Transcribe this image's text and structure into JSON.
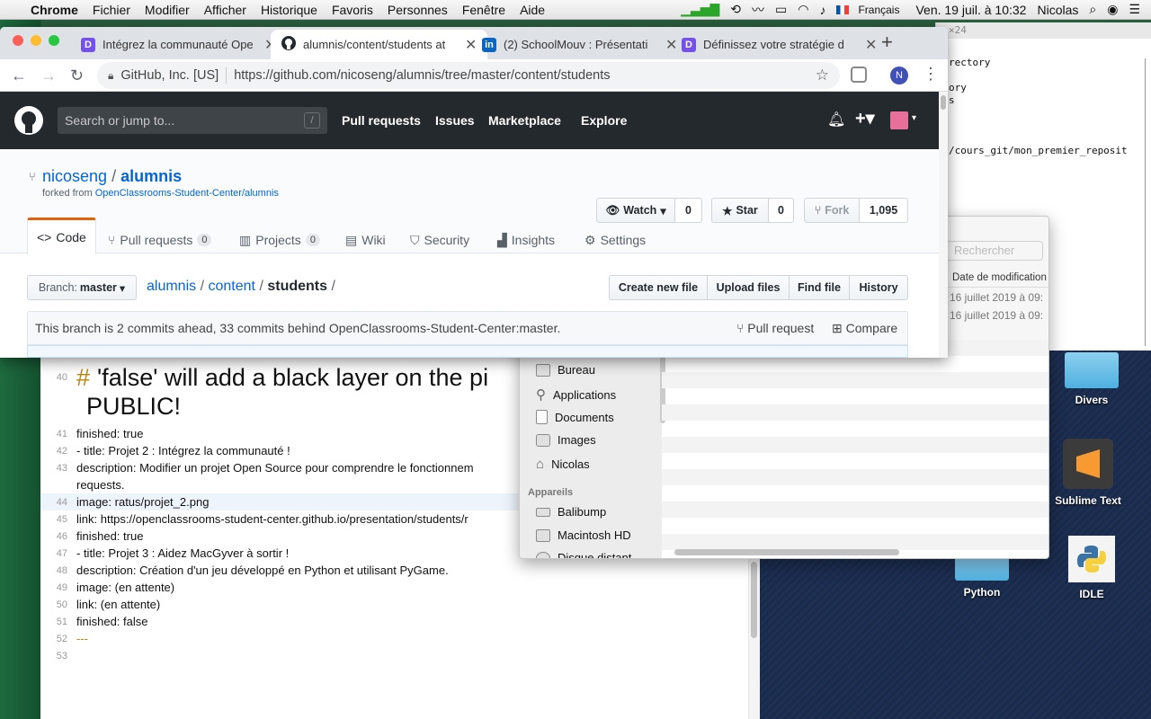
{
  "menubar": {
    "app": "Chrome",
    "items": [
      "Fichier",
      "Modifier",
      "Afficher",
      "Historique",
      "Favoris",
      "Personnes",
      "Fenêtre",
      "Aide"
    ],
    "input_source": "Français",
    "datetime": "Ven. 19 juil. à 10:32",
    "user": "Nicolas"
  },
  "browser": {
    "tabs": [
      {
        "title": "Intégrez la communauté Ope",
        "favicon": "openclassrooms-icon"
      },
      {
        "title": "alumnis/content/students at",
        "favicon": "github-icon",
        "active": true
      },
      {
        "title": "(2) SchoolMouv : Présentati",
        "favicon": "linkedin-icon"
      },
      {
        "title": "Définissez votre stratégie d",
        "favicon": "openclassrooms-icon"
      }
    ],
    "site_identity": "GitHub, Inc. [US]",
    "url": "https://github.com/nicoseng/alumnis/tree/master/content/students",
    "profile_initial": "N"
  },
  "github": {
    "search_placeholder": "Search or jump to...",
    "search_shortcut": "/",
    "nav": [
      "Pull requests",
      "Issues",
      "Marketplace",
      "Explore"
    ],
    "repo_owner": "nicoseng",
    "repo_sep": "/",
    "repo_name": "alumnis",
    "forked_prefix": "forked from",
    "forked_from": "OpenClassrooms-Student-Center/alumnis",
    "watch_label": "Watch",
    "watch_count": "0",
    "star_label": "Star",
    "star_count": "0",
    "fork_label": "Fork",
    "fork_count": "1,095",
    "tabs": [
      {
        "label": "Code"
      },
      {
        "label": "Pull requests",
        "count": "0"
      },
      {
        "label": "Projects",
        "count": "0"
      },
      {
        "label": "Wiki"
      },
      {
        "label": "Security"
      },
      {
        "label": "Insights"
      },
      {
        "label": "Settings"
      }
    ],
    "branch_label": "Branch:",
    "branch_value": "master",
    "path": [
      "alumnis",
      "content",
      "students"
    ],
    "path_sep": "/",
    "buttons": [
      "Create new file",
      "Upload files",
      "Find file",
      "History"
    ],
    "branch_status": "This branch is 2 commits ahead, 33 commits behind OpenClassrooms-Student-Center:master.",
    "pull_request_label": "Pull request",
    "compare_label": "Compare"
  },
  "editor": {
    "heading_line_no": "40",
    "heading_hash": "#",
    "heading_text": "'false' will add a black layer on the pi",
    "heading_cont": "PUBLIC!",
    "lines": [
      {
        "n": "41",
        "text": "finished: true"
      },
      {
        "n": "42",
        "text": "- title: Projet 2 : Intégrez la communauté !"
      },
      {
        "n": "43",
        "text": "description: Modifier un projet Open Source pour comprendre le fonctionnem"
      },
      {
        "n": "",
        "text": "requests."
      },
      {
        "n": "44",
        "text": "image: ratus/projet_2.png"
      },
      {
        "n": "45",
        "text": "link: https://openclassrooms-student-center.github.io/presentation/students/r"
      },
      {
        "n": "46",
        "text": "finished: true"
      },
      {
        "n": "47",
        "text": "- title: Projet 3 : Aidez MacGyver à sortir !"
      },
      {
        "n": "48",
        "text": "description: Création d'un jeu développé en Python et utilisant PyGame."
      },
      {
        "n": "49",
        "text": "image: (en attente)"
      },
      {
        "n": "50",
        "text": "link: (en attente)"
      },
      {
        "n": "51",
        "text": "finished: false"
      },
      {
        "n": "52",
        "text": "---"
      },
      {
        "n": "53",
        "text": ""
      }
    ]
  },
  "terminal": {
    "title": "×24",
    "lines": [
      "rectory",
      "ory",
      "s",
      "/cours_git/mon_premier_reposit"
    ]
  },
  "finder": {
    "search_placeholder": "Rechercher",
    "column_header": "Date de modification",
    "dates": [
      "16 juillet 2019 à 09:",
      "16 juillet 2019 à 09:"
    ],
    "favorites": [
      "Bureau",
      "Applications",
      "Documents",
      "Images",
      "Nicolas"
    ],
    "devices_header": "Appareils",
    "devices": [
      "Balibump",
      "Macintosh HD",
      "Disque distant"
    ]
  },
  "desktop": {
    "icons": [
      "Divers",
      "Sublime Text",
      "Python",
      "IDLE"
    ]
  }
}
